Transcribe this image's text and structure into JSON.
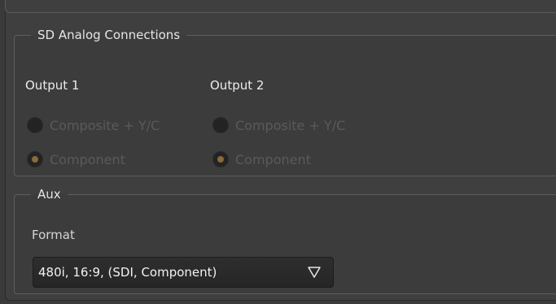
{
  "sd_analog": {
    "legend": "SD Analog Connections",
    "output1": {
      "label": "Output 1",
      "options": [
        {
          "label": "Composite + Y/C",
          "selected": false
        },
        {
          "label": "Component",
          "selected": true
        }
      ]
    },
    "output2": {
      "label": "Output 2",
      "options": [
        {
          "label": "Composite + Y/C",
          "selected": false
        },
        {
          "label": "Component",
          "selected": true
        }
      ]
    }
  },
  "aux": {
    "legend": "Aux",
    "format_label": "Format",
    "format_value": "480i, 16:9, (SDI, Component)"
  },
  "colors": {
    "selected_dot": "#8a6a3c",
    "disabled_text": "#5a5a5a"
  },
  "icons": {
    "dropdown": "triangle-down-icon"
  }
}
